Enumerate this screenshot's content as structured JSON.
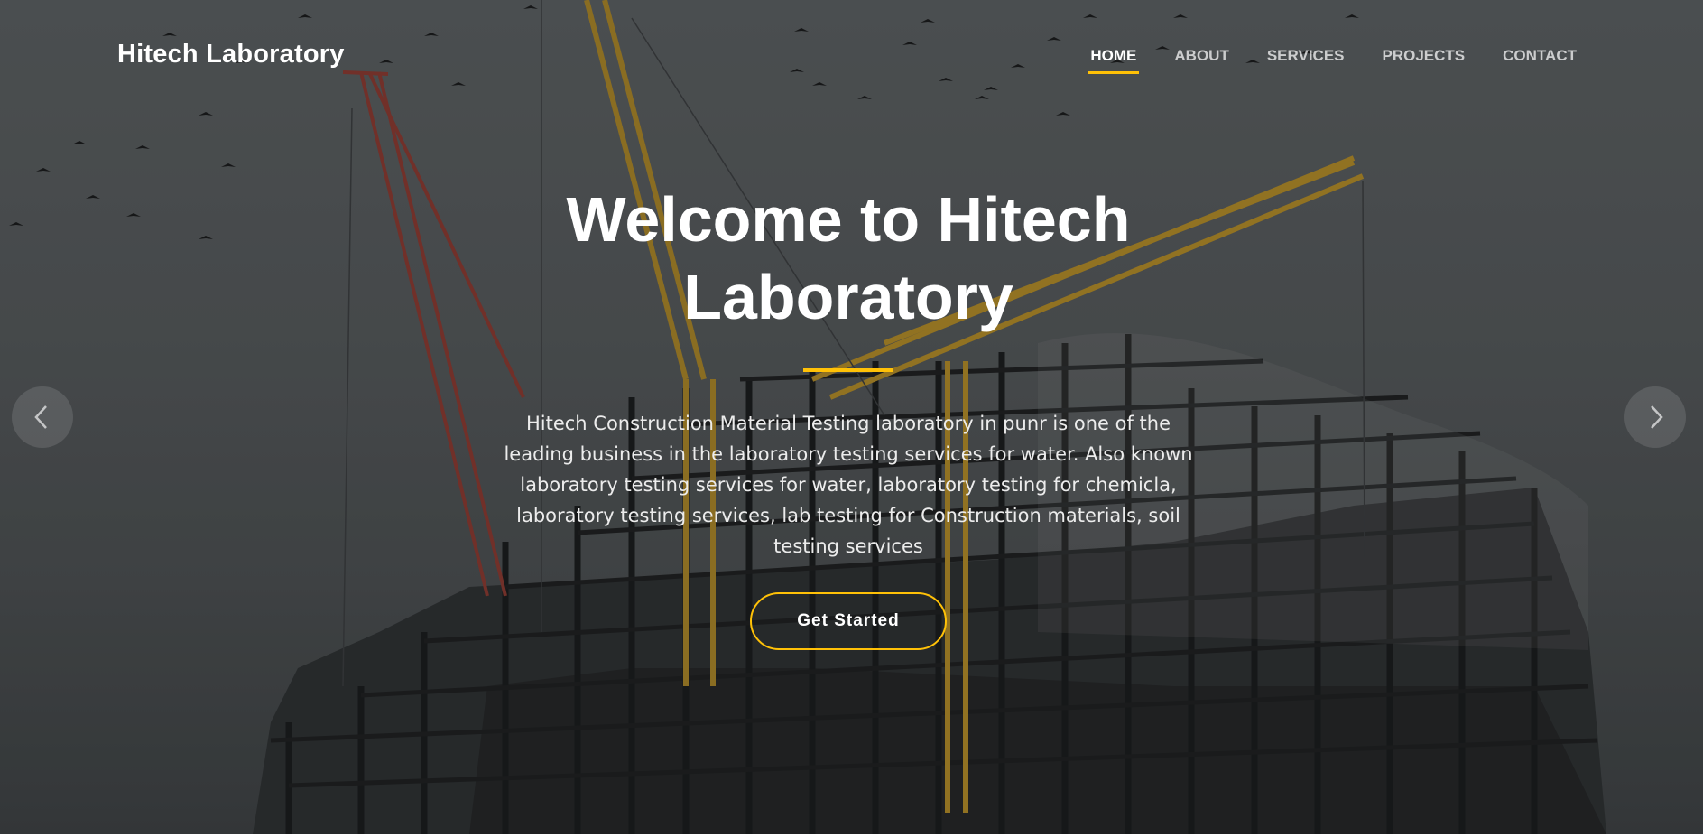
{
  "brand": {
    "name": "Hitech Laboratory",
    "accent_color": "#ffc107"
  },
  "nav": {
    "items": [
      {
        "label": "HOME",
        "active": true
      },
      {
        "label": "ABOUT",
        "active": false
      },
      {
        "label": "SERVICES",
        "active": false
      },
      {
        "label": "PROJECTS",
        "active": false
      },
      {
        "label": "CONTACT",
        "active": false
      }
    ]
  },
  "hero": {
    "title_line1": "Welcome to Hitech",
    "title_line2": "Laboratory",
    "description": "Hitech Construction Material Testing laboratory in punr is one of the leading business in the laboratory testing services for water. Also known laboratory testing services for water, laboratory testing for chemicla, laboratory testing services, lab testing for Construction materials, soil testing services",
    "cta_label": "Get Started"
  },
  "carousel": {
    "prev_icon": "chevron-left-icon",
    "next_icon": "chevron-right-icon"
  }
}
